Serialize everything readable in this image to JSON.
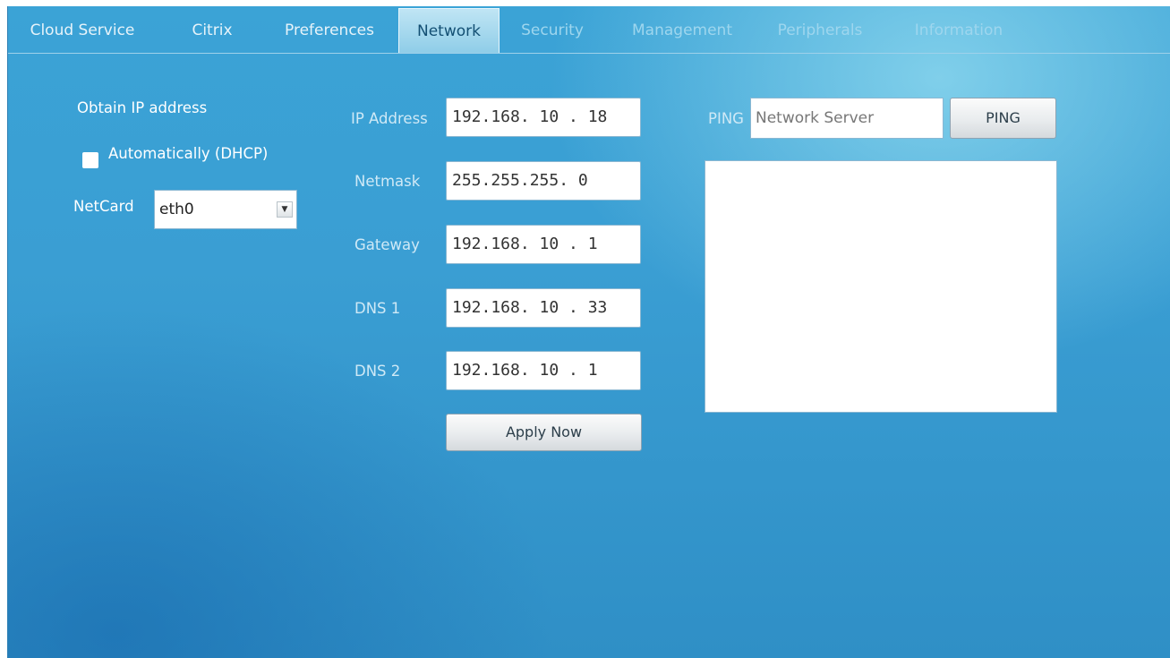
{
  "tabs": [
    {
      "label": "Cloud Service",
      "state": "normal"
    },
    {
      "label": "Citrix",
      "state": "normal"
    },
    {
      "label": "Preferences",
      "state": "normal"
    },
    {
      "label": "Network",
      "state": "active"
    },
    {
      "label": "Security",
      "state": "faded"
    },
    {
      "label": "Management",
      "state": "faded"
    },
    {
      "label": "Peripherals",
      "state": "faded"
    },
    {
      "label": "Information",
      "state": "faded"
    }
  ],
  "obtain": {
    "heading": "Obtain IP address",
    "dhcp_label": "Automatically (DHCP)",
    "dhcp_checked": false
  },
  "netcard": {
    "label": "NetCard",
    "value": "eth0",
    "arrow_icon": "dropdown-arrow-icon"
  },
  "network": {
    "ip_label": "IP Address",
    "ip_value": "192.168. 10 . 18",
    "netmask_label": "Netmask",
    "netmask_value": "255.255.255. 0",
    "gateway_label": "Gateway",
    "gateway_value": "192.168. 10 . 1",
    "dns1_label": "DNS 1",
    "dns1_value": "192.168. 10 . 33",
    "dns2_label": "DNS 2",
    "dns2_value": "192.168. 10 . 1",
    "apply_label": "Apply Now"
  },
  "ping": {
    "label": "PING",
    "placeholder": "Network Server",
    "button_label": "PING",
    "output": ""
  },
  "colors": {
    "background": "#3a9ed3",
    "active_tab": "#a8dbef",
    "field_bg": "#ffffff"
  }
}
